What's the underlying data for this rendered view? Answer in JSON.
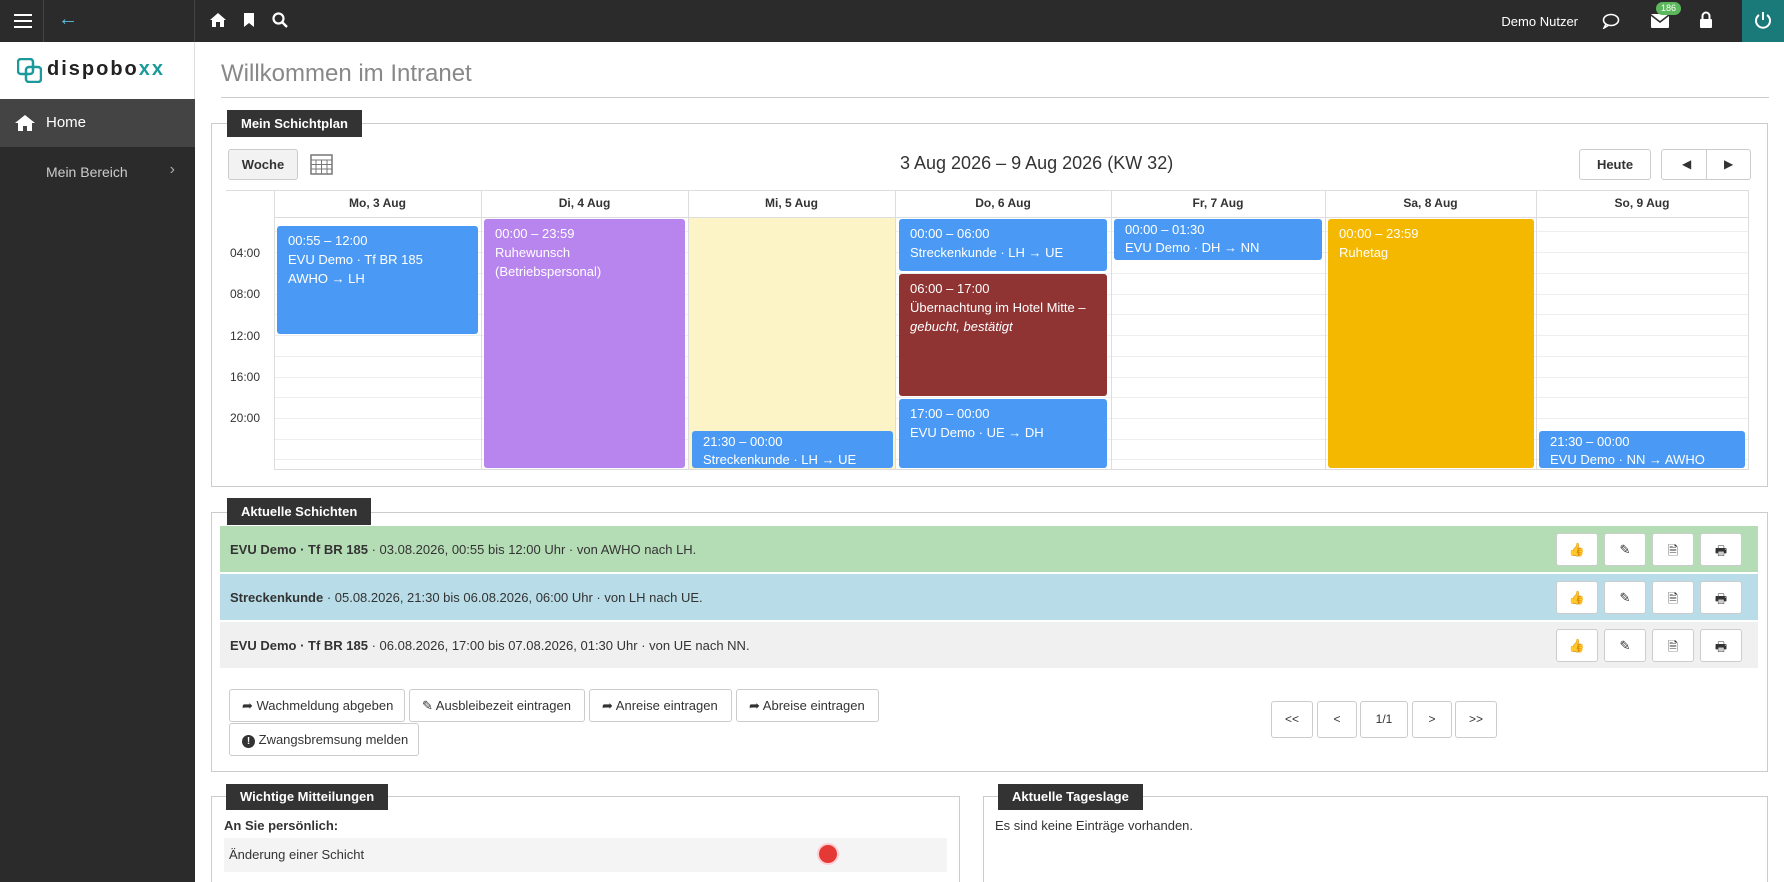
{
  "topbar": {
    "user_name": "Demo Nutzer",
    "mail_badge": "186"
  },
  "logo": {
    "text_main": "dispobo",
    "text_accent": "xx"
  },
  "sidebar": {
    "items": [
      {
        "label": "Home"
      },
      {
        "label": "Mein Bereich"
      }
    ]
  },
  "page": {
    "title": "Willkommen im Intranet"
  },
  "schedule": {
    "tab": "Mein Schichtplan",
    "view_button": "Woche",
    "range_title": "3 Aug 2026 – 9 Aug 2026 (KW 32)",
    "today_button": "Heute",
    "days": [
      "Mo, 3 Aug",
      "Di, 4 Aug",
      "Mi, 5 Aug",
      "Do, 6 Aug",
      "Fr, 7 Aug",
      "Sa, 8 Aug",
      "So, 9 Aug"
    ],
    "time_labels": [
      "04:00",
      "08:00",
      "12:00",
      "16:00",
      "20:00"
    ],
    "events": [
      {
        "time": "00:55 – 12:00",
        "line1": "EVU Demo · Tf BR 185",
        "line2": "AWHO → LH",
        "color": "#4a9af5"
      },
      {
        "time": "00:00 – 23:59",
        "line1": "Ruhewunsch",
        "line2": "(Betriebspersonal)",
        "color": "#b884ee"
      },
      {
        "time": "21:30 – 00:00",
        "line1": "Streckenkunde · LH → UE",
        "color": "#4a9af5"
      },
      {
        "time": "00:00 – 06:00",
        "line1": "Streckenkunde · LH → UE",
        "color": "#4a9af5"
      },
      {
        "time": "06:00 – 17:00",
        "line1": "Übernachtung im Hotel Mitte –",
        "line2": "gebucht, bestätigt",
        "color": "#8f3333"
      },
      {
        "time": "17:00 – 00:00",
        "line1": "EVU Demo · UE → DH",
        "color": "#4a9af5"
      },
      {
        "time": "00:00 – 01:30",
        "line1": "EVU Demo · DH → NN",
        "color": "#4a9af5"
      },
      {
        "time": "00:00 – 23:59",
        "line1": "Ruhetag",
        "color": "#f5b800"
      },
      {
        "time": "21:30 – 00:00",
        "line1": "EVU Demo · NN → AWHO",
        "color": "#4a9af5"
      }
    ]
  },
  "current_shifts": {
    "tab": "Aktuelle Schichten",
    "rows": [
      {
        "bold": "EVU Demo · Tf BR 185",
        "rest": " · 03.08.2026, 00:55 bis 12:00 Uhr · von AWHO nach LH.",
        "bg": "#b5ddb5"
      },
      {
        "bold": "Streckenkunde",
        "rest": " · 05.08.2026, 21:30 bis 06.08.2026, 06:00 Uhr · von LH nach UE.",
        "bg": "#b8dde8"
      },
      {
        "bold": "EVU Demo · Tf BR 185",
        "rest": " · 06.08.2026, 17:00 bis 07.08.2026, 01:30 Uhr · von UE nach NN.",
        "bg": "#f0f0f0"
      }
    ],
    "actions": [
      "Wachmeldung abgeben",
      "Ausbleibezeit eintragen",
      "Anreise eintragen",
      "Abreise eintragen",
      "Zwangsbremsung melden"
    ],
    "pagination": {
      "first": "<<",
      "prev": "<",
      "page": "1/1",
      "next": ">",
      "last": ">>"
    }
  },
  "messages": {
    "tab": "Wichtige Mitteilungen",
    "heading": "An Sie persönlich:",
    "item": "Änderung einer Schicht"
  },
  "daily": {
    "tab": "Aktuelle Tageslage",
    "empty": "Es sind keine Einträge vorhanden."
  }
}
